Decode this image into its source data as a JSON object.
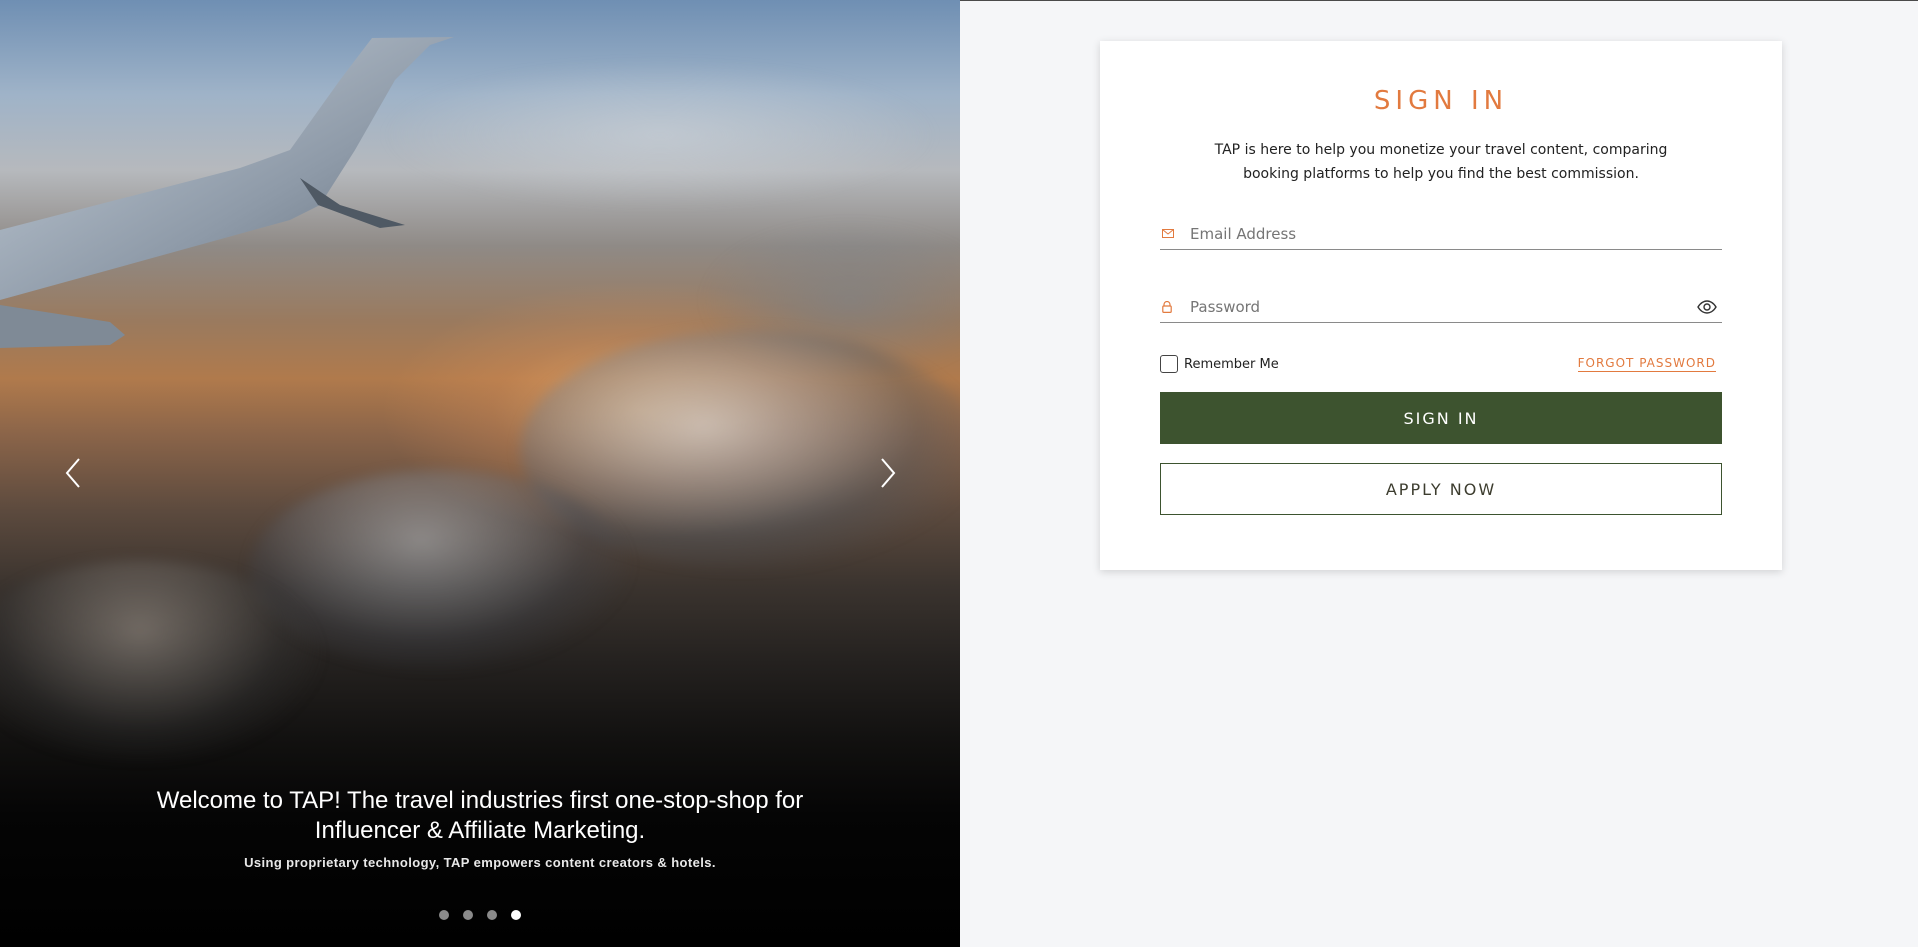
{
  "hero": {
    "headline": "Welcome to TAP! The travel industries first one-stop-shop for Influencer & Affiliate Marketing.",
    "subheadline": "Using proprietary technology, TAP empowers content creators & hotels.",
    "slides": 4,
    "active_slide": 4,
    "prev_icon": "chevron-left-icon",
    "next_icon": "chevron-right-icon"
  },
  "signin": {
    "title": "SIGN IN",
    "intro": "TAP is here to help you monetize your travel content, comparing booking platforms to help you find the best commission.",
    "email": {
      "placeholder": "Email Address",
      "value": "",
      "icon": "mail-icon"
    },
    "password": {
      "placeholder": "Password",
      "value": "",
      "icon": "lock-icon",
      "toggle_icon": "eye-icon"
    },
    "remember_label": "Remember Me",
    "remember_checked": false,
    "forgot_label": "FORGOT PASSWORD",
    "signin_button": "SIGN IN",
    "apply_button": "APPLY NOW"
  },
  "colors": {
    "accent": "#e27a3f",
    "primary_button": "#3d532f",
    "panel_bg": "#f5f6f8"
  }
}
